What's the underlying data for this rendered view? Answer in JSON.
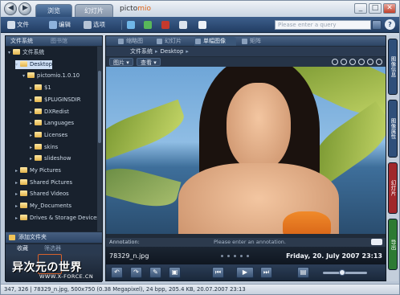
{
  "titlebar": {
    "back_glyph": "◀",
    "forward_glyph": "▶",
    "tabs": [
      {
        "label": "浏览"
      },
      {
        "label": "幻灯片"
      }
    ],
    "app_name": "picto",
    "app_name_accent": "mio",
    "window_controls": {
      "min": "_",
      "max": "□",
      "close": "✕"
    }
  },
  "toolbar": {
    "file_label": "文件",
    "edit_label": "编辑",
    "options_label": "选项",
    "search_placeholder": "Please enter a query",
    "help_glyph": "?"
  },
  "left_panel": {
    "tabs": [
      {
        "label": "文件系统"
      },
      {
        "label": "图书馆"
      }
    ],
    "tree": [
      {
        "label": "文件系统",
        "level": 0,
        "arrow": "▾"
      },
      {
        "label": "Desktop",
        "level": 1,
        "arrow": "▾",
        "selected": true
      },
      {
        "label": "pictomio.1.0.10",
        "level": 2,
        "arrow": "▾"
      },
      {
        "label": "$1",
        "level": 3,
        "arrow": "▸"
      },
      {
        "label": "$PLUGINSDIR",
        "level": 3,
        "arrow": "▸"
      },
      {
        "label": "DXRedist",
        "level": 3,
        "arrow": "▸"
      },
      {
        "label": "Languages",
        "level": 3,
        "arrow": "▸"
      },
      {
        "label": "Licenses",
        "level": 3,
        "arrow": "▸"
      },
      {
        "label": "skins",
        "level": 3,
        "arrow": "▸"
      },
      {
        "label": "slideshow",
        "level": 3,
        "arrow": "▸"
      },
      {
        "label": "My Pictures",
        "level": 1,
        "arrow": "▸"
      },
      {
        "label": "Shared Pictures",
        "level": 1,
        "arrow": "▸"
      },
      {
        "label": "Shared Videos",
        "level": 1,
        "arrow": "▸"
      },
      {
        "label": "My_Documents",
        "level": 1,
        "arrow": "▸"
      },
      {
        "label": "Drives & Storage Devices",
        "level": 1,
        "arrow": "▸"
      }
    ],
    "add_folder_label": "添加文件夹",
    "fav_tabs": [
      {
        "label": "收藏"
      },
      {
        "label": "筛选器"
      }
    ],
    "watermark_line1": "异次元の世界",
    "watermark_line2": "WWW.X-FORCE.CN"
  },
  "main": {
    "tabs": [
      {
        "label": "缩略图"
      },
      {
        "label": "幻灯片"
      },
      {
        "label": "单幅图像"
      },
      {
        "label": "矩阵"
      }
    ],
    "breadcrumb": [
      "文件系统",
      "Desktop"
    ],
    "view_buttons": [
      {
        "label": "图片 ▾"
      },
      {
        "label": "查看 ▾"
      }
    ],
    "annotation_label": "Annotation:",
    "annotation_placeholder": "Please enter an annotation.",
    "filename": "78329_n.jpg",
    "date": "Friday, 20. July 2007 23:13",
    "controls": [
      {
        "glyph": "↶"
      },
      {
        "glyph": "↷"
      },
      {
        "glyph": "✎"
      },
      {
        "glyph": "▣"
      },
      {
        "glyph": "⏮"
      },
      {
        "glyph": "▶"
      },
      {
        "glyph": "⏭"
      },
      {
        "glyph": "▤"
      }
    ]
  },
  "right_tabs": [
    {
      "label": "图像信息",
      "color": "#2f4f7a"
    },
    {
      "label": "图像属性",
      "color": "#2f4f7a"
    },
    {
      "label": "幻灯片",
      "color": "#a0282b"
    },
    {
      "label": "导出",
      "color": "#2d7a33"
    }
  ],
  "status": {
    "text": "347, 326 | 78329_n.jpg, 500x750 (0.38 Megapixel), 24 bpp, 205.4 KB, 20.07.2007 23:13"
  },
  "colors": {
    "accent": "#2e4e78",
    "dark_panel": "#1f2a38",
    "orange": "#e0661a"
  }
}
